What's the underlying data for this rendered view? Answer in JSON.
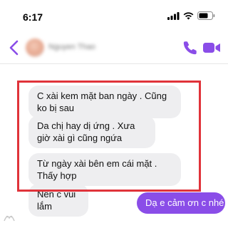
{
  "status_bar": {
    "time": "6:17",
    "icons": [
      "cellular-signal-icon",
      "wifi-icon",
      "battery-icon"
    ]
  },
  "header": {
    "contact_name": "Nguyen Thao",
    "icons": [
      "back-chevron-icon",
      "phone-icon",
      "video-camera-icon"
    ],
    "accent_color": "#8a4de8"
  },
  "messages": [
    {
      "direction": "incoming",
      "text": "C xài kem mặt ban ngày . Cũng ko bị sau"
    },
    {
      "direction": "incoming",
      "text": "Da chị hay dị ứng . Xưa giờ xài gì cũng ngứa"
    },
    {
      "direction": "incoming",
      "text": "Từ ngày xài bên em cái mặt . Thấy hợp"
    },
    {
      "direction": "incoming",
      "text": "Nên c vui lắm"
    },
    {
      "direction": "outgoing",
      "text": "Dạ e cảm ơn c nhé"
    }
  ],
  "colors": {
    "incoming_bubble": "#eeeef0",
    "outgoing_bubble": "#8a4de8",
    "highlight_box": "#e0333a"
  }
}
